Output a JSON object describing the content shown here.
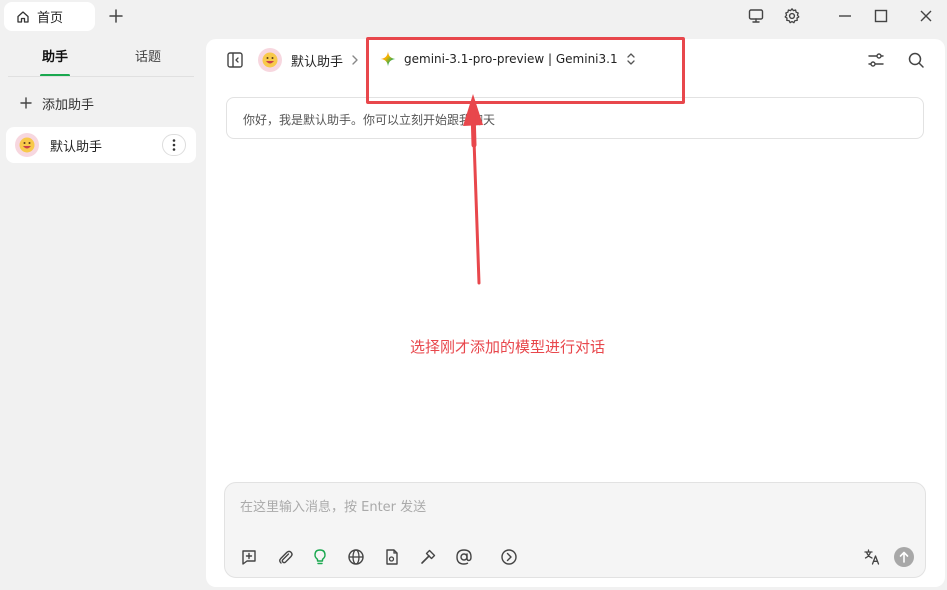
{
  "titlebar": {
    "home_tab_label": "首页"
  },
  "sidebar": {
    "tabs": [
      {
        "label": "助手",
        "active": true
      },
      {
        "label": "话题",
        "active": false
      }
    ],
    "add_assistant_label": "添加助手",
    "assistants": [
      {
        "name": "默认助手"
      }
    ]
  },
  "header": {
    "assistant_name": "默认助手",
    "model_name": "gemini-3.1-pro-preview | Gemini3.1"
  },
  "chat": {
    "greeting": "你好，我是默认助手。你可以立刻开始跟我聊天"
  },
  "annotation": {
    "text": "选择刚才添加的模型进行对话",
    "color": "#e8474c"
  },
  "input": {
    "placeholder": "在这里输入消息，按 Enter 发送",
    "value": ""
  },
  "colors": {
    "accent": "#1aa84f",
    "annotation": "#e8474c"
  }
}
